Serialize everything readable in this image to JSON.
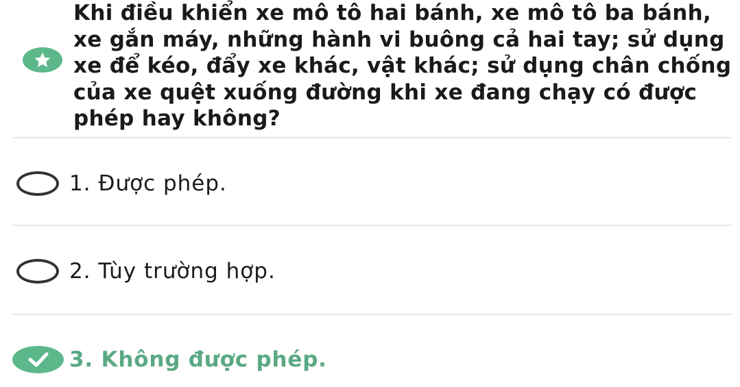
{
  "question": {
    "text": "Khi điều khiển xe mô tô hai bánh, xe mô tô ba bánh, xe gắn máy, những hành vi buông cả hai tay; sử dụng xe để kéo, đẩy xe khác, vật khác; sử dụng chân chống của xe quệt xuống đường khi xe đang chạy có được phép hay không?",
    "badge_icon": "star-icon"
  },
  "answers": [
    {
      "label": "1. Được phép.",
      "state": "unselected"
    },
    {
      "label": "2. Tùy trường hợp.",
      "state": "unselected"
    },
    {
      "label": "3. Không được phép.",
      "state": "correct"
    }
  ],
  "colors": {
    "accent_green": "#5cb88a",
    "correct_text": "#5aa983",
    "radio_border": "#333333",
    "divider": "#e6e6e6"
  }
}
